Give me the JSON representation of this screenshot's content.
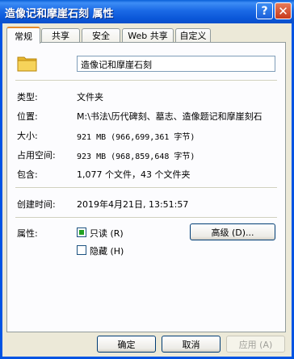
{
  "window": {
    "title": "造像记和摩崖石刻 属性",
    "help": "?",
    "close": "✕"
  },
  "tabs": [
    {
      "label": "常规"
    },
    {
      "label": "共享"
    },
    {
      "label": "安全"
    },
    {
      "label": "Web 共享"
    },
    {
      "label": "自定义"
    }
  ],
  "general": {
    "name": "造像记和摩崖石刻",
    "rows": [
      {
        "label": "类型:",
        "value": "文件夹"
      },
      {
        "label": "位置:",
        "value": "M:\\书法\\历代碑刻、墓志、造像题记和摩崖刻石"
      },
      {
        "label": "大小:",
        "value": "921 MB (966,699,361 字节)"
      },
      {
        "label": "占用空间:",
        "value": "923 MB (968,859,648 字节)"
      },
      {
        "label": "包含:",
        "value": "1,077 个文件，43 个文件夹"
      }
    ],
    "created_label": "创建时间:",
    "created_value": "2019年4月21日, 13:51:57",
    "attr_label": "属性:",
    "readonly_label": "只读 (R)",
    "hidden_label": "隐藏 (H)",
    "advanced_label": "高级 (D)...",
    "readonly_checked": true,
    "hidden_checked": false
  },
  "buttons": {
    "ok": "确定",
    "cancel": "取消",
    "apply": "应用 (A)"
  },
  "colors": {
    "title_bar": "#0a5fd8",
    "dialog_bg": "#ece9d8",
    "tab_accent": "#e68b2c",
    "check_green": "#21a121"
  }
}
